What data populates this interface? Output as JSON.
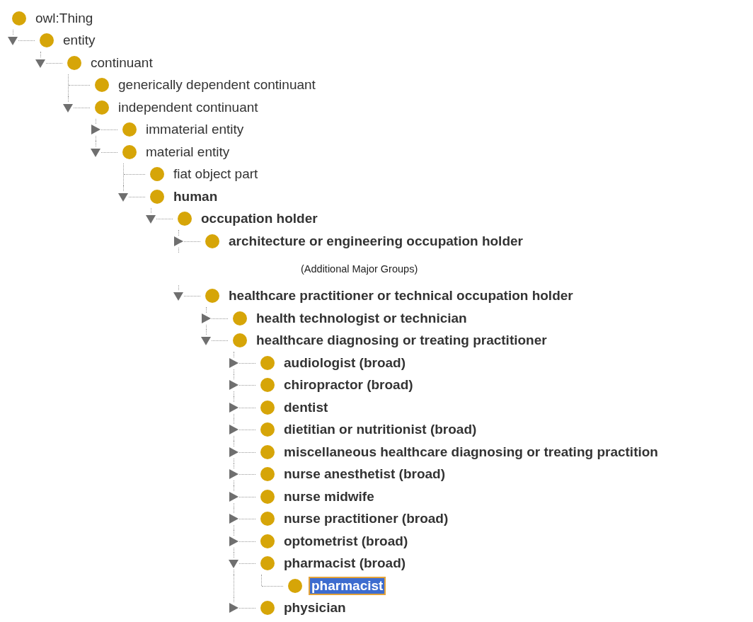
{
  "tree": {
    "label": "owl:Thing",
    "bold": false,
    "selected": false,
    "children": [
      {
        "label": "entity",
        "bold": false,
        "selected": false,
        "expanded": true,
        "children": [
          {
            "label": "continuant",
            "bold": false,
            "selected": false,
            "expanded": true,
            "children": [
              {
                "label": "generically dependent continuant",
                "bold": false,
                "selected": false
              },
              {
                "label": "independent continuant",
                "bold": false,
                "selected": false,
                "expanded": true,
                "children": [
                  {
                    "label": "immaterial entity",
                    "bold": false,
                    "selected": false,
                    "expanded": false
                  },
                  {
                    "label": "material entity",
                    "bold": false,
                    "selected": false,
                    "expanded": true,
                    "children": [
                      {
                        "label": "fiat object part",
                        "bold": false,
                        "selected": false
                      },
                      {
                        "label": "human",
                        "bold": true,
                        "selected": false,
                        "expanded": true,
                        "children": [
                          {
                            "label": "occupation holder",
                            "bold": true,
                            "selected": false,
                            "expanded": true,
                            "children": [
                              {
                                "kind": "class",
                                "label": "architecture or engineering occupation holder",
                                "bold": true,
                                "selected": false,
                                "expanded": false
                              },
                              {
                                "kind": "note",
                                "label": "(Additional Major Groups)"
                              },
                              {
                                "kind": "class",
                                "label": "healthcare practitioner or technical occupation holder",
                                "bold": true,
                                "selected": false,
                                "expanded": true,
                                "children": [
                                  {
                                    "label": "health technologist or technician",
                                    "bold": true,
                                    "selected": false,
                                    "expanded": false
                                  },
                                  {
                                    "label": "healthcare diagnosing or treating practitioner",
                                    "bold": true,
                                    "selected": false,
                                    "expanded": true,
                                    "children": [
                                      {
                                        "label": "audiologist (broad)",
                                        "bold": true,
                                        "selected": false,
                                        "expanded": false
                                      },
                                      {
                                        "label": "chiropractor (broad)",
                                        "bold": true,
                                        "selected": false,
                                        "expanded": false
                                      },
                                      {
                                        "label": "dentist",
                                        "bold": true,
                                        "selected": false,
                                        "expanded": false
                                      },
                                      {
                                        "label": "dietitian or nutritionist (broad)",
                                        "bold": true,
                                        "selected": false,
                                        "expanded": false
                                      },
                                      {
                                        "label": "miscellaneous healthcare diagnosing or treating practition",
                                        "bold": true,
                                        "selected": false,
                                        "expanded": false
                                      },
                                      {
                                        "label": "nurse anesthetist (broad)",
                                        "bold": true,
                                        "selected": false,
                                        "expanded": false
                                      },
                                      {
                                        "label": "nurse midwife",
                                        "bold": true,
                                        "selected": false,
                                        "expanded": false
                                      },
                                      {
                                        "label": "nurse practitioner (broad)",
                                        "bold": true,
                                        "selected": false,
                                        "expanded": false
                                      },
                                      {
                                        "label": "optometrist (broad)",
                                        "bold": true,
                                        "selected": false,
                                        "expanded": false
                                      },
                                      {
                                        "label": "pharmacist (broad)",
                                        "bold": true,
                                        "selected": false,
                                        "expanded": true,
                                        "children": [
                                          {
                                            "label": "pharmacist",
                                            "bold": true,
                                            "selected": true
                                          }
                                        ]
                                      },
                                      {
                                        "label": "physician",
                                        "bold": true,
                                        "selected": false,
                                        "expanded": false
                                      }
                                    ]
                                  }
                                ]
                              }
                            ]
                          }
                        ]
                      }
                    ]
                  }
                ]
              }
            ]
          }
        ]
      }
    ]
  }
}
